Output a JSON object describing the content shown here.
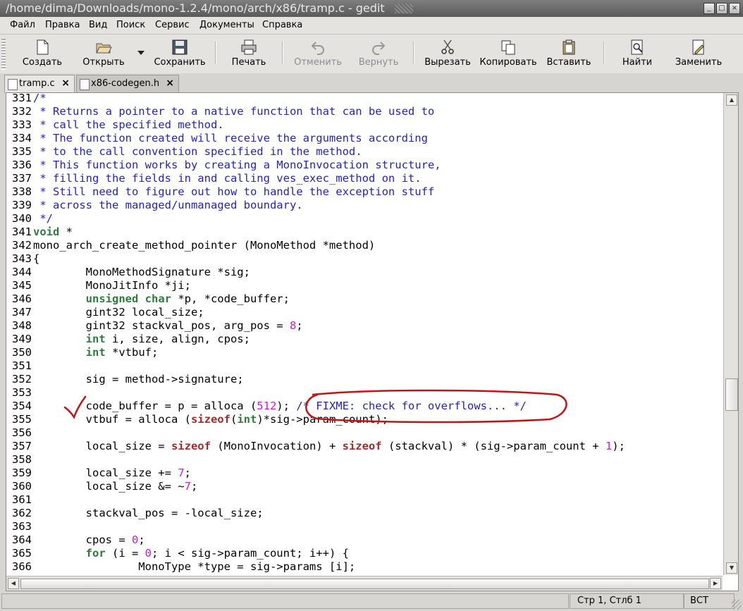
{
  "window": {
    "title": "/home/dima/Downloads/mono-1.2.4/mono/arch/x86/tramp.c - gedit",
    "buttons": [
      "_",
      "□",
      "×"
    ]
  },
  "menu": [
    "Файл",
    "Правка",
    "Вид",
    "Поиск",
    "Сервис",
    "Документы",
    "Справка"
  ],
  "toolbar": {
    "new": "Создать",
    "open": "Открыть",
    "save": "Сохранить",
    "print": "Печать",
    "undo": "Отменить",
    "redo": "Вернуть",
    "cut": "Вырезать",
    "copy": "Копировать",
    "paste": "Вставить",
    "find": "Найти",
    "replace": "Заменить"
  },
  "tabs": [
    {
      "label": "tramp.c",
      "active": true
    },
    {
      "label": "x86-codegen.h",
      "active": false
    }
  ],
  "editor": {
    "lines": [
      {
        "n": "331",
        "t": "/*"
      },
      {
        "n": "332",
        "t": " * Returns a pointer to a native function that can be used to"
      },
      {
        "n": "333",
        "t": " * call the specified method."
      },
      {
        "n": "334",
        "t": " * The function created will receive the arguments according"
      },
      {
        "n": "335",
        "t": " * to the call convention specified in the method."
      },
      {
        "n": "336",
        "t": " * This function works by creating a MonoInvocation structure,"
      },
      {
        "n": "337",
        "t": " * filling the fields in and calling ves_exec_method on it."
      },
      {
        "n": "338",
        "t": " * Still need to figure out how to handle the exception stuff"
      },
      {
        "n": "339",
        "t": " * across the managed/unmanaged boundary."
      },
      {
        "n": "340",
        "t": " */"
      },
      {
        "n": "341",
        "t": "void *"
      },
      {
        "n": "342",
        "t": "mono_arch_create_method_pointer (MonoMethod *method)"
      },
      {
        "n": "343",
        "t": "{"
      },
      {
        "n": "344",
        "t": "        MonoMethodSignature *sig;"
      },
      {
        "n": "345",
        "t": "        MonoJitInfo *ji;"
      },
      {
        "n": "346",
        "t": "        unsigned char *p, *code_buffer;"
      },
      {
        "n": "347",
        "t": "        gint32 local_size;"
      },
      {
        "n": "348",
        "t": "        gint32 stackval_pos, arg_pos = 8;"
      },
      {
        "n": "349",
        "t": "        int i, size, align, cpos;"
      },
      {
        "n": "350",
        "t": "        int *vtbuf;"
      },
      {
        "n": "351",
        "t": ""
      },
      {
        "n": "352",
        "t": "        sig = method->signature;"
      },
      {
        "n": "353",
        "t": ""
      },
      {
        "n": "354",
        "t": "        code_buffer = p = alloca (512); /* FIXME: check for overflows... */"
      },
      {
        "n": "355",
        "t": "        vtbuf = alloca (sizeof(int)*sig->param_count);"
      },
      {
        "n": "356",
        "t": ""
      },
      {
        "n": "357",
        "t": "        local_size = sizeof (MonoInvocation) + sizeof (stackval) * (sig->param_count + 1);"
      },
      {
        "n": "358",
        "t": ""
      },
      {
        "n": "359",
        "t": "        local_size += 7;"
      },
      {
        "n": "360",
        "t": "        local_size &= ~7;"
      },
      {
        "n": "361",
        "t": ""
      },
      {
        "n": "362",
        "t": "        stackval_pos = -local_size;"
      },
      {
        "n": "363",
        "t": ""
      },
      {
        "n": "364",
        "t": "        cpos = 0;"
      },
      {
        "n": "365",
        "t": "        for (i = 0; i < sig->param_count; i++) {"
      },
      {
        "n": "366",
        "t": "                MonoType *type = sig->params [i];"
      }
    ]
  },
  "status": {
    "position": "Стр 1, Стлб 1",
    "mode": "ВСТ"
  },
  "colors": {
    "comment": "#2222c8",
    "keyword": "#2e7b3e",
    "keyword_sizeof": "#a52a2a",
    "number": "#d018d0",
    "annotation": "#c21414"
  },
  "icons": [
    "new-icon",
    "open-icon",
    "save-icon",
    "print-icon",
    "undo-icon",
    "redo-icon",
    "cut-icon",
    "copy-icon",
    "paste-icon",
    "find-icon",
    "replace-icon",
    "checkmark-annotation",
    "circle-annotation"
  ]
}
